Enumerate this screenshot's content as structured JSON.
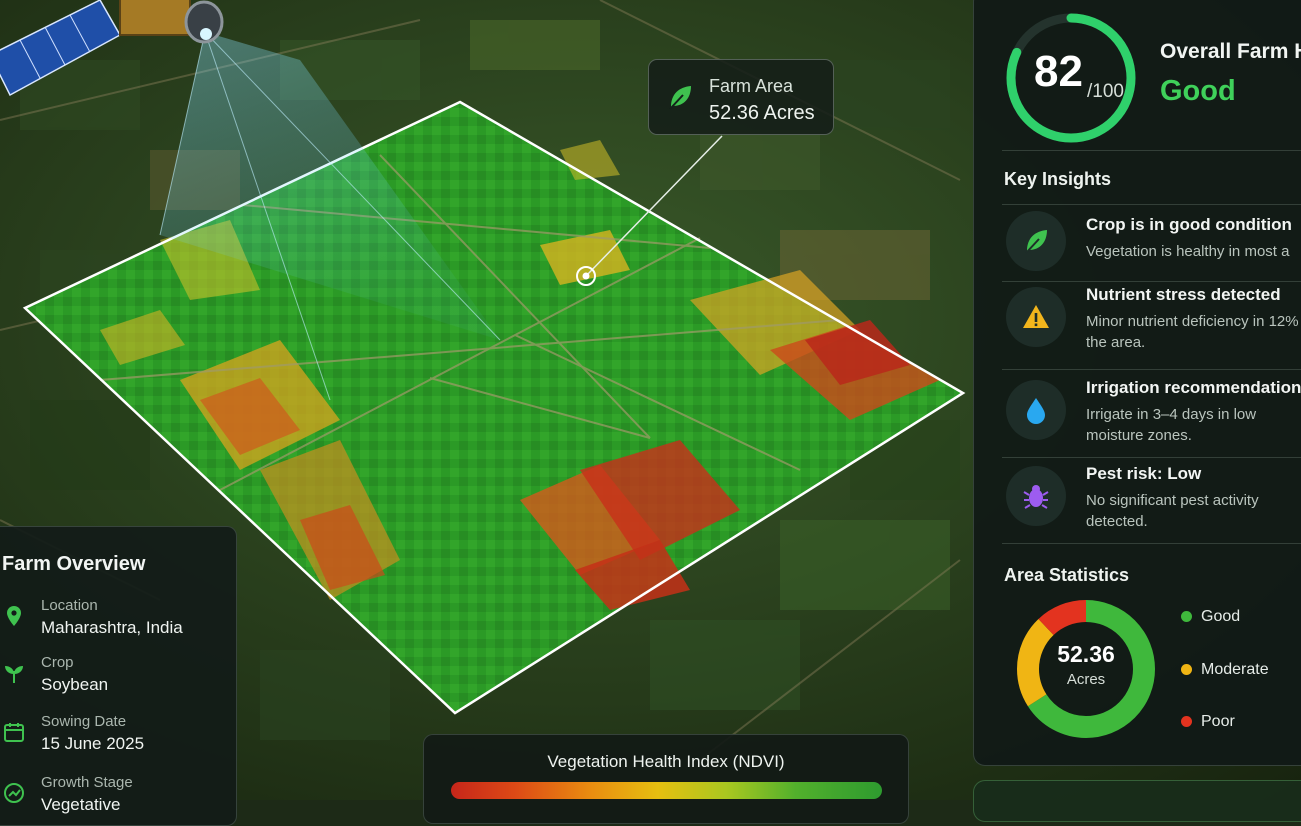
{
  "callout": {
    "label": "Farm Area",
    "value": "52.36 Acres",
    "icon": "leaf-icon"
  },
  "health": {
    "score": "82",
    "score_denominator": "/100",
    "score_fraction": 0.82,
    "title": "Overall Farm H",
    "status": "Good",
    "colors": {
      "ring": "#2fd06b",
      "good": "#3fd15a"
    }
  },
  "insights": {
    "title": "Key Insights",
    "items": [
      {
        "title": "Crop is in good condition",
        "desc": "Vegetation is healthy in most a",
        "icon": "leaf-icon",
        "color": "#3fc24f"
      },
      {
        "title": "Nutrient stress detected",
        "desc": "Minor nutrient deficiency in 12% of the area.",
        "icon": "warning-icon",
        "color": "#f2b51c"
      },
      {
        "title": "Irrigation recommendation",
        "desc": "Irrigate in 3–4 days in low moisture zones.",
        "icon": "water-drop-icon",
        "color": "#29a8f0"
      },
      {
        "title": "Pest risk: Low",
        "desc": "No significant pest activity detected.",
        "icon": "bug-icon",
        "color": "#9d5cf0"
      }
    ]
  },
  "area_stats": {
    "title": "Area Statistics",
    "total": "52.36",
    "unit": "Acres",
    "legend": [
      {
        "label": "Good",
        "color": "#3fb83c"
      },
      {
        "label": "Moderate",
        "color": "#f0b514"
      },
      {
        "label": "Poor",
        "color": "#e3331f"
      }
    ]
  },
  "overview": {
    "title": "Farm Overview",
    "items": [
      {
        "key": "Location",
        "value": "Maharashtra, India",
        "icon": "location-pin-icon"
      },
      {
        "key": "Crop",
        "value": "Soybean",
        "icon": "plant-icon"
      },
      {
        "key": "Sowing Date",
        "value": "15 June 2025",
        "icon": "calendar-icon"
      },
      {
        "key": "Growth Stage",
        "value": "Vegetative",
        "icon": "growth-icon"
      }
    ]
  },
  "ndvi": {
    "title": "Vegetation Health Index (NDVI)"
  }
}
